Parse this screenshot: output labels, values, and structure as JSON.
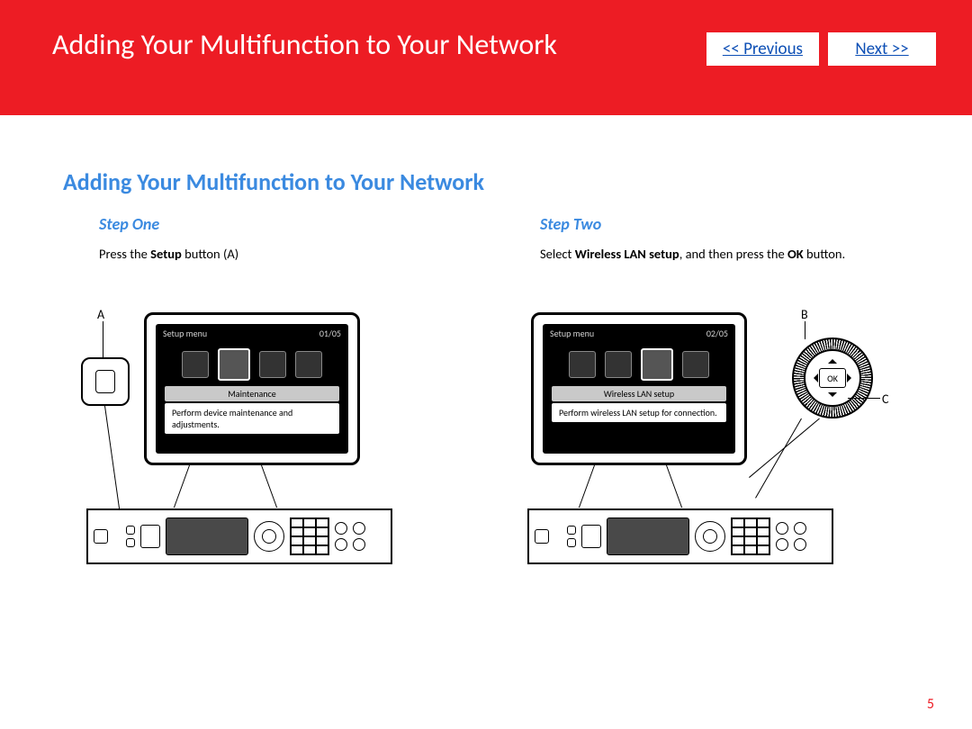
{
  "header": {
    "title": "Adding Your Multifunction to Your Network",
    "prev": "<< Previous",
    "next": "Next >>"
  },
  "section": {
    "title": "Adding Your Multifunction to Your Network"
  },
  "steps": [
    {
      "title": "Step One",
      "text_pre": "Press the ",
      "text_bold": "Setup",
      "text_post": " button (A)",
      "lcd": {
        "menu": "Setup menu",
        "page": "01/05",
        "label": "Maintenance",
        "desc": "Perform device maintenance and adjustments."
      },
      "callouts": {
        "a": "A"
      }
    },
    {
      "title": "Step Two",
      "text_pre": "Select ",
      "text_bold": "Wireless LAN setup",
      "text_mid": ", and then press the ",
      "text_bold2": "OK",
      "text_post": " button.",
      "lcd": {
        "menu": "Setup menu",
        "page": "02/05",
        "label": "Wireless LAN setup",
        "desc": "Perform wireless LAN setup for connection."
      },
      "callouts": {
        "b": "B",
        "c": "C",
        "ok": "OK"
      }
    }
  ],
  "page_number": "5"
}
